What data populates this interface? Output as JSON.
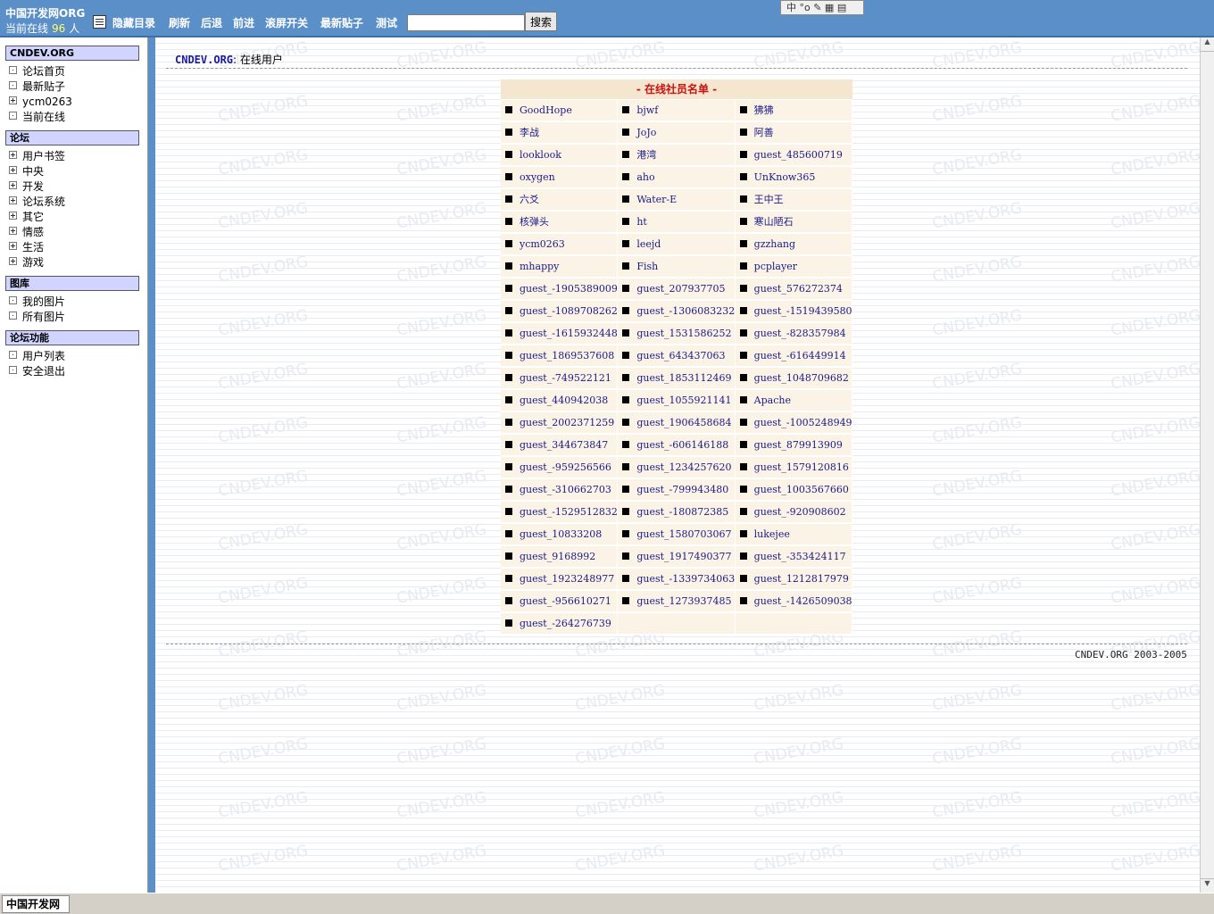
{
  "topbar": {
    "site_title": "中国开发网ORG",
    "online_prefix": "当前在线",
    "online_count": "96",
    "online_suffix": "人",
    "nav": [
      "隐藏目录",
      "刷新",
      "后退",
      "前进",
      "滚屏开关",
      "最新贴子",
      "测试"
    ],
    "search_value": "",
    "search_button": "搜索",
    "ime_text": "中 °o ✎ ▦ ▤"
  },
  "sidebar": {
    "sections": [
      {
        "title": "CNDEV.ORG",
        "items": [
          {
            "label": "论坛首页",
            "marker": "dot"
          },
          {
            "label": "最新贴子",
            "marker": "dot"
          },
          {
            "label": "ycm0263",
            "marker": "plus"
          },
          {
            "label": "当前在线",
            "marker": "dot"
          }
        ]
      },
      {
        "title": "论坛",
        "items": [
          {
            "label": "用户书签",
            "marker": "plus"
          },
          {
            "label": "中央",
            "marker": "plus"
          },
          {
            "label": "开发",
            "marker": "plus"
          },
          {
            "label": "论坛系统",
            "marker": "plus"
          },
          {
            "label": "其它",
            "marker": "plus"
          },
          {
            "label": "情感",
            "marker": "plus"
          },
          {
            "label": "生活",
            "marker": "plus"
          },
          {
            "label": "游戏",
            "marker": "plus"
          }
        ]
      },
      {
        "title": "图库",
        "items": [
          {
            "label": "我的图片",
            "marker": "dot"
          },
          {
            "label": "所有图片",
            "marker": "dot"
          }
        ]
      },
      {
        "title": "论坛功能",
        "items": [
          {
            "label": "用户列表",
            "marker": "dot"
          },
          {
            "label": "安全退出",
            "marker": "dot"
          }
        ]
      }
    ]
  },
  "main": {
    "crumb_site": "CNDEV.ORG",
    "crumb_sep": ":",
    "crumb_page": "在线用户",
    "table_title": "- 在线社员名单 -",
    "members": [
      "GoodHope",
      "bjwf",
      "狒狒",
      "李战",
      "JoJo",
      "阿善",
      "looklook",
      "港湾",
      "guest_485600719",
      "oxygen",
      "aho",
      "UnKnow365",
      "六爻",
      "Water-E",
      "王中王",
      "核弹头",
      "ht",
      "寒山陋石",
      "ycm0263",
      "leejd",
      "gzzhang",
      "mhappy",
      "Fish",
      "pcplayer",
      "guest_-1905389009",
      "guest_207937705",
      "guest_576272374",
      "guest_-1089708262",
      "guest_-1306083232",
      "guest_-1519439580",
      "guest_-1615932448",
      "guest_1531586252",
      "guest_-828357984",
      "guest_1869537608",
      "guest_643437063",
      "guest_-616449914",
      "guest_-749522121",
      "guest_1853112469",
      "guest_1048709682",
      "guest_440942038",
      "guest_1055921141",
      "Apache",
      "guest_2002371259",
      "guest_1906458684",
      "guest_-1005248949",
      "guest_344673847",
      "guest_-606146188",
      "guest_879913909",
      "guest_-959256566",
      "guest_1234257620",
      "guest_1579120816",
      "guest_-310662703",
      "guest_-799943480",
      "guest_1003567660",
      "guest_-1529512832",
      "guest_-180872385",
      "guest_-920908602",
      "guest_10833208",
      "guest_1580703067",
      "lukejee",
      "guest_9168992",
      "guest_1917490377",
      "guest_-353424117",
      "guest_1923248977",
      "guest_-1339734063",
      "guest_1212817979",
      "guest_-956610271",
      "guest_1273937485",
      "guest_-1426509038",
      "guest_-264276739"
    ],
    "footer": "CNDEV.ORG 2003-2005",
    "watermark": "CNDEV.ORG"
  },
  "statusbar": {
    "label": "中国开发网"
  }
}
